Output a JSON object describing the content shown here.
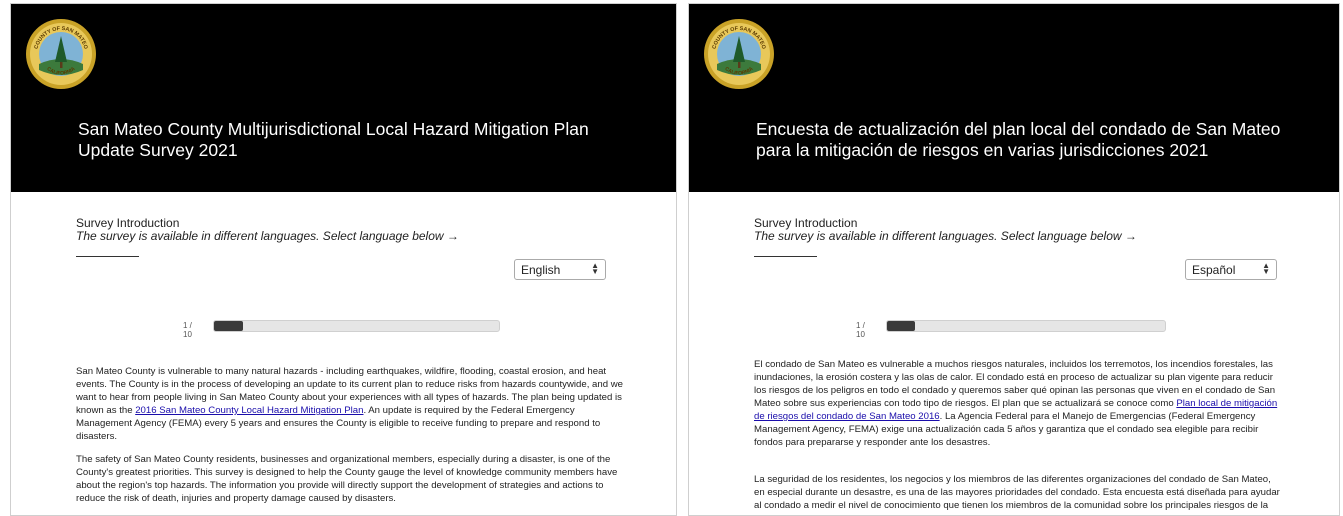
{
  "colors": {
    "header_bg": "#000000",
    "link": "#1a0dab",
    "progress_fill": "#3a3a3a"
  },
  "english": {
    "logo": {
      "text_top": "COUNTY OF SAN MATEO",
      "text_bottom": "CALIFORNIA",
      "icon": "county-seal-logo"
    },
    "title": "San Mateo County Multijurisdictional Local Hazard Mitigation Plan Update Survey 2021",
    "intro_heading": "Survey Introduction",
    "intro_subtitle": "The survey is available in different languages. Select language below →",
    "language_select": "English",
    "progress": {
      "label": "1 / 10",
      "fraction": 0.1
    },
    "para1_pre": "San Mateo County is vulnerable to many natural hazards - including earthquakes, wildfire, flooding, coastal erosion, and heat events. The County is in the process of developing an update to its current plan to reduce risks from hazards countywide, and we want to hear from people living in San Mateo County about your experiences with all types of hazards. The plan being updated is known as the ",
    "para1_link": "2016 San Mateo County Local Hazard Mitigation Plan",
    "para1_post": ". An update is required by the Federal Emergency Management Agency (FEMA) every 5 years and ensures the County is eligible to receive funding to prepare and respond to disasters.",
    "para2": "The safety of San Mateo County residents, businesses and organizational members, especially during a disaster, is one of the County's greatest priorities. This survey is designed to help the County gauge the level of knowledge community members have about the region's top hazards. The information you provide will directly support the development of strategies and actions to reduce the risk of death, injuries and property damage caused by disasters."
  },
  "spanish": {
    "logo": {
      "text_top": "COUNTY OF SAN MATEO",
      "text_bottom": "CALIFORNIA",
      "icon": "county-seal-logo"
    },
    "title": "Encuesta de actualización del plan local del condado de San Mateo para la mitigación de riesgos en varias jurisdicciones 2021",
    "intro_heading": "Survey Introduction",
    "intro_subtitle": "The survey is available in different languages. Select language below →",
    "language_select": "Español",
    "progress": {
      "label": "1 / 10",
      "fraction": 0.1
    },
    "para1_pre": "El condado de San Mateo es vulnerable a muchos riesgos naturales, incluidos los terremotos, los incendios forestales, las inundaciones, la erosión costera y las olas de calor. El condado está en proceso de actualizar su plan vigente para reducir los riesgos de los peligros en todo el condado y queremos saber qué opinan las personas que viven en el condado de San Mateo sobre sus experiencias con todo tipo de riesgos. El plan que se actualizará se conoce como ",
    "para1_link": "Plan local de mitigación de riesgos del condado de San Mateo 2016",
    "para1_post": ". La Agencia Federal para el Manejo de Emergencias (Federal Emergency Management Agency, FEMA) exige una actualización cada 5 años y garantiza que el condado sea elegible para recibir fondos para prepararse y responder ante los desastres.",
    "para2": "La seguridad de los residentes, los negocios y los miembros de las diferentes organizaciones del condado de San Mateo, en especial durante un desastre, es una de las mayores prioridades del condado. Esta encuesta está diseñada para ayudar al condado a medir el nivel de conocimiento que tienen los miembros de la comunidad sobre los principales riesgos de la"
  }
}
